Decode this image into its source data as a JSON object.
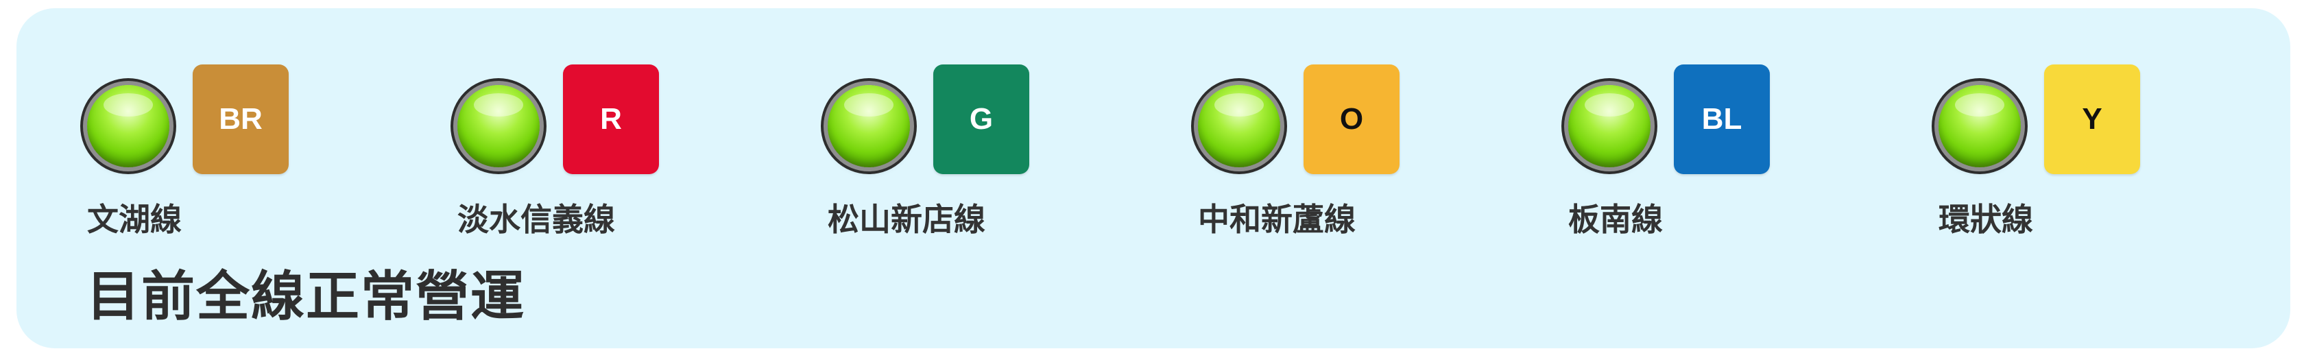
{
  "lines": [
    {
      "code": "BR",
      "name": "文湖線",
      "badge_color": "#c98e38",
      "code_color": "#ffffff",
      "status_icon": "green-status-light-icon"
    },
    {
      "code": "R",
      "name": "淡水信義線",
      "badge_color": "#e30b2f",
      "code_color": "#ffffff",
      "status_icon": "green-status-light-icon"
    },
    {
      "code": "G",
      "name": "松山新店線",
      "badge_color": "#13875d",
      "code_color": "#ffffff",
      "status_icon": "green-status-light-icon"
    },
    {
      "code": "O",
      "name": "中和新蘆線",
      "badge_color": "#f6b531",
      "code_color": "#111111",
      "status_icon": "green-status-light-icon"
    },
    {
      "code": "BL",
      "name": "板南線",
      "badge_color": "#0f70be",
      "code_color": "#ffffff",
      "status_icon": "green-status-light-icon"
    },
    {
      "code": "Y",
      "name": "環狀線",
      "badge_color": "#f8d93a",
      "code_color": "#111111",
      "status_icon": "green-status-light-icon"
    }
  ],
  "status": {
    "message": "目前全線正常營運"
  },
  "colors": {
    "panel_background": "#dff6fd",
    "text": "#333333"
  }
}
